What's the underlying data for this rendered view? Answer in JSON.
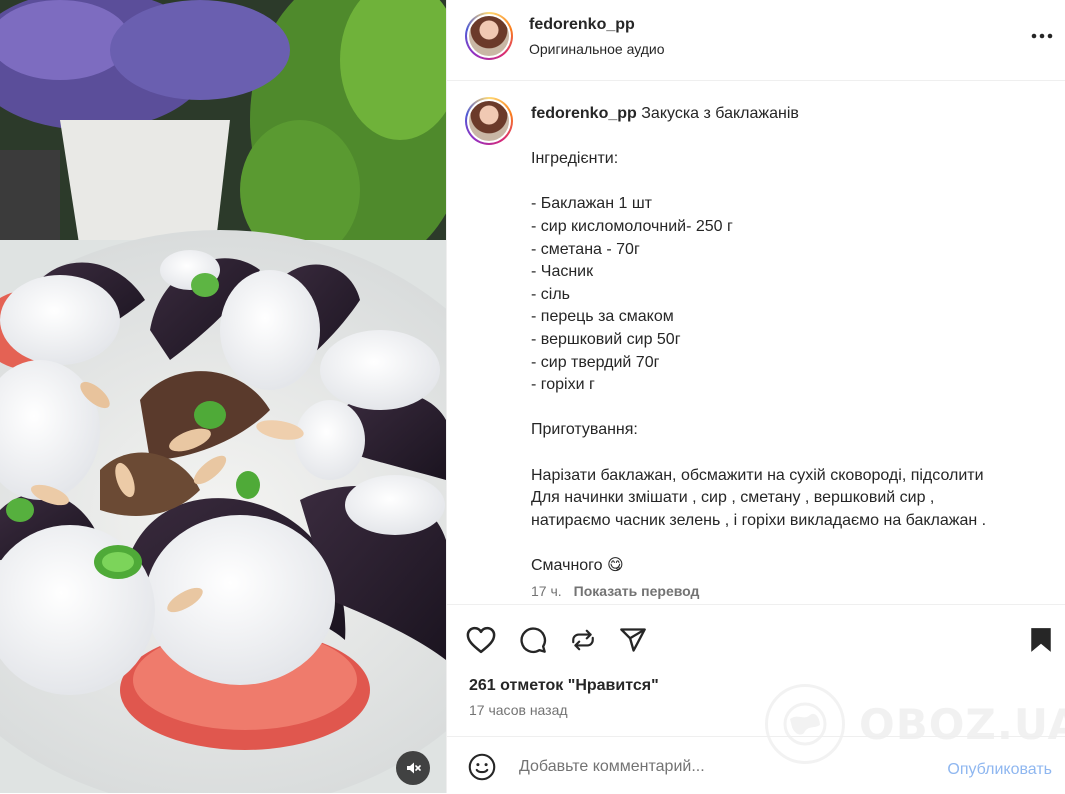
{
  "header": {
    "username": "fedorenko_pp",
    "audio": "Оригинальное аудио"
  },
  "caption": {
    "username": "fedorenko_pp",
    "title": "Закуска з баклажанів",
    "lines": [
      "",
      "Інгредієнти:",
      "",
      "- Баклажан 1 шт",
      "- сир кисломолочний- 250 г",
      "- сметана - 70г",
      "- Часник",
      "- сіль",
      "- перець за смаком",
      "- вершковий сир 50г",
      "- сир твердий 70г",
      "- горіхи г",
      "",
      "Приготування:",
      "",
      "Нарізати баклажан, обсмажити на сухій сковороді, підсолити",
      "Для начинки змішати , сир , сметану , вершковий сир ,",
      "натираємо часник зелень , і горіхи викладаємо на баклажан .",
      "",
      "Смачного 😋"
    ],
    "age": "17 ч.",
    "translate": "Показать перевод"
  },
  "stats": {
    "likes": "261 отметок \"Нравится\"",
    "time": "17 часов назад"
  },
  "comment": {
    "placeholder": "Добавьте комментарий...",
    "publish": "Опубликовать"
  },
  "watermark": "OBOZ.UA",
  "icons": [
    "mute-icon",
    "more-icon",
    "heart-icon",
    "comment-icon",
    "repost-icon",
    "share-icon",
    "bookmark-icon",
    "emoji-icon"
  ],
  "colors": {
    "accent_link": "#8fb7f0",
    "secondary_text": "#737373"
  }
}
